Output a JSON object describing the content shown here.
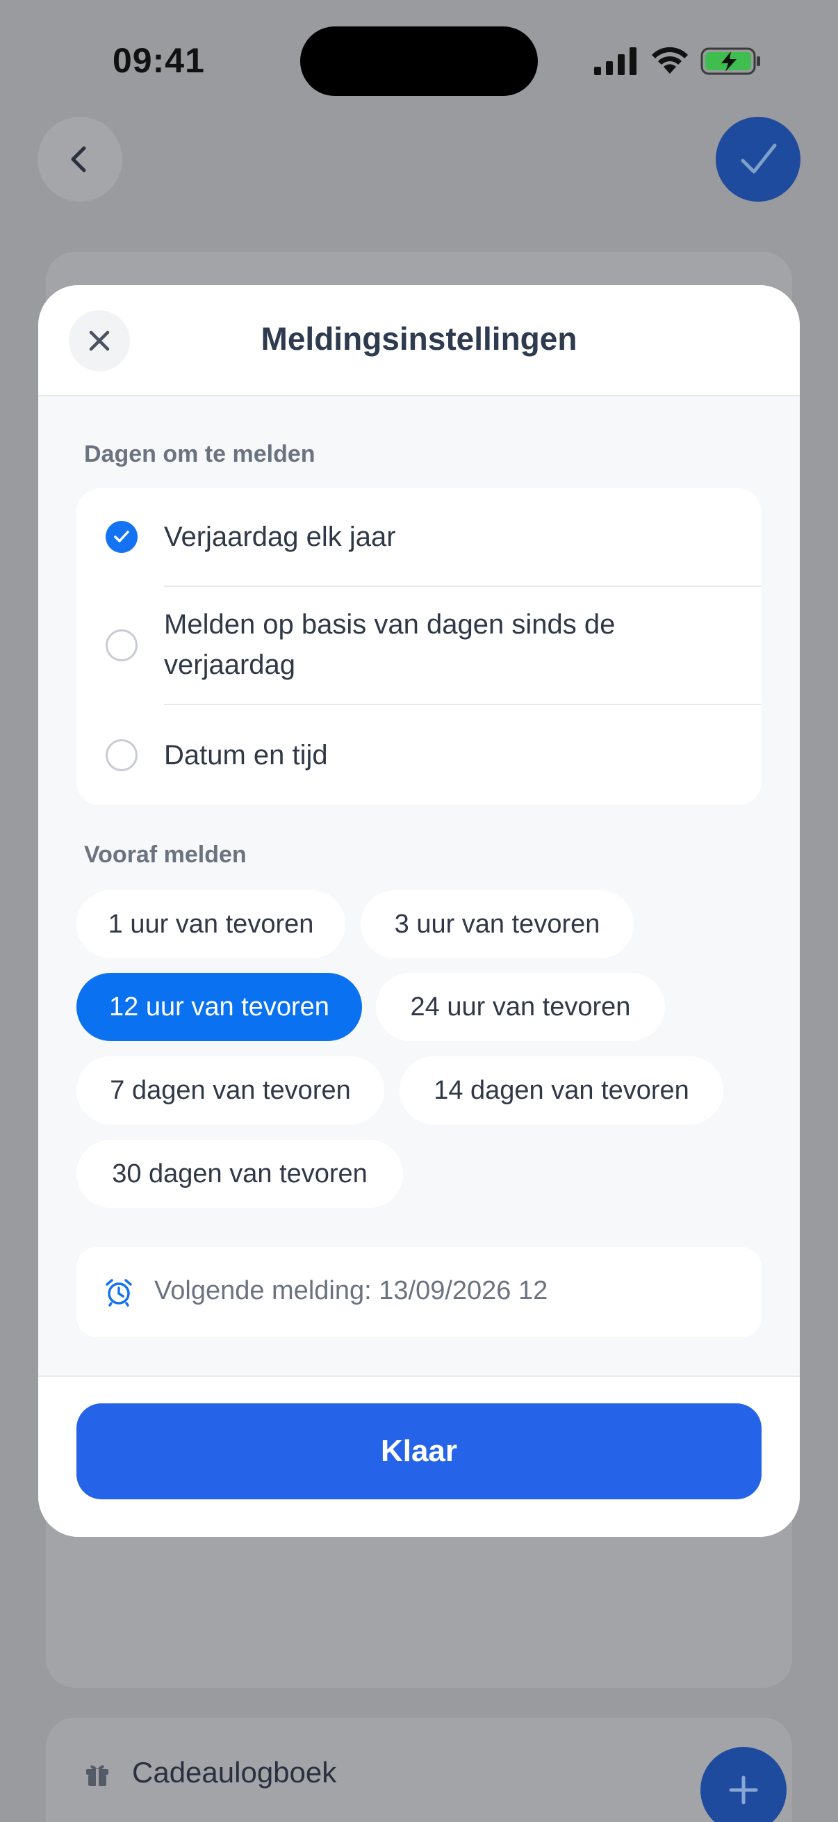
{
  "status_bar": {
    "time": "09:41"
  },
  "background": {
    "gift_log_label": "Cadeaulogboek"
  },
  "modal": {
    "title": "Meldingsinstellingen",
    "days_section_label": "Dagen om te melden",
    "options": [
      {
        "label": "Verjaardag elk jaar",
        "checked": true
      },
      {
        "label": "Melden op basis van dagen sinds de verjaardag",
        "checked": false
      },
      {
        "label": "Datum en tijd",
        "checked": false
      }
    ],
    "advance_section_label": "Vooraf melden",
    "chips": [
      {
        "label": "1 uur van tevoren",
        "selected": false
      },
      {
        "label": "3 uur van tevoren",
        "selected": false
      },
      {
        "label": "12 uur van tevoren",
        "selected": true
      },
      {
        "label": "24 uur van tevoren",
        "selected": false
      },
      {
        "label": "7 dagen van tevoren",
        "selected": false
      },
      {
        "label": "14 dagen van tevoren",
        "selected": false
      },
      {
        "label": "30 dagen van tevoren",
        "selected": false
      }
    ],
    "next_notification": "Volgende melding: 13/09/2026 12",
    "done_label": "Klaar"
  },
  "colors": {
    "accent": "#2563e8",
    "chip_selected": "#0a72f0",
    "checkbox": "#1473f3"
  }
}
